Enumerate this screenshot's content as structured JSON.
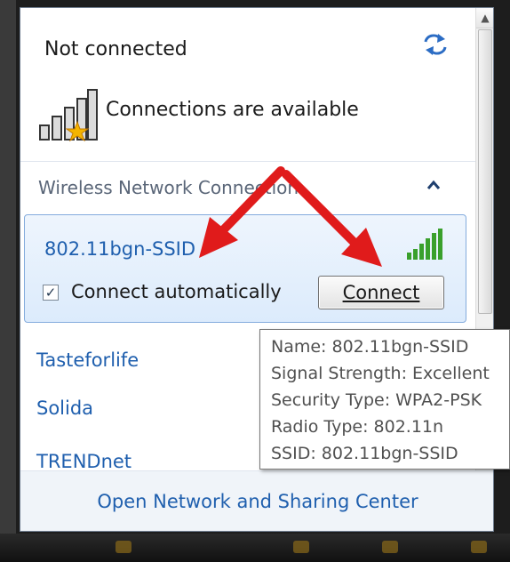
{
  "status": {
    "title": "Not connected",
    "subtitle": "Connections are available",
    "refresh_icon": "refresh-icon",
    "signal_icon": "signal-star-icon"
  },
  "section": {
    "label": "Wireless Network Connection",
    "collapse_icon": "chevron-up-icon"
  },
  "selected_network": {
    "ssid": "802.11bgn-SSID",
    "connect_auto_label": "Connect automatically",
    "connect_auto_checked": true,
    "connect_button_label": "Connect",
    "signal_icon": "signal-bars-icon"
  },
  "networks": [
    {
      "name": "Tasteforlife"
    },
    {
      "name": "Solida"
    },
    {
      "name": "TRENDnet"
    }
  ],
  "footer": {
    "link": "Open Network and Sharing Center"
  },
  "tooltip": {
    "name": "Name: 802.11bgn-SSID",
    "signal": "Signal Strength: Excellent",
    "security": "Security Type: WPA2-PSK",
    "radio": "Radio Type: 802.11n",
    "ssid": "SSID: 802.11bgn-SSID"
  },
  "colors": {
    "link": "#1f5fae",
    "selection_bg": "#dcebfc",
    "arrow": "#e01b1b",
    "signal_green": "#3aa02c"
  }
}
